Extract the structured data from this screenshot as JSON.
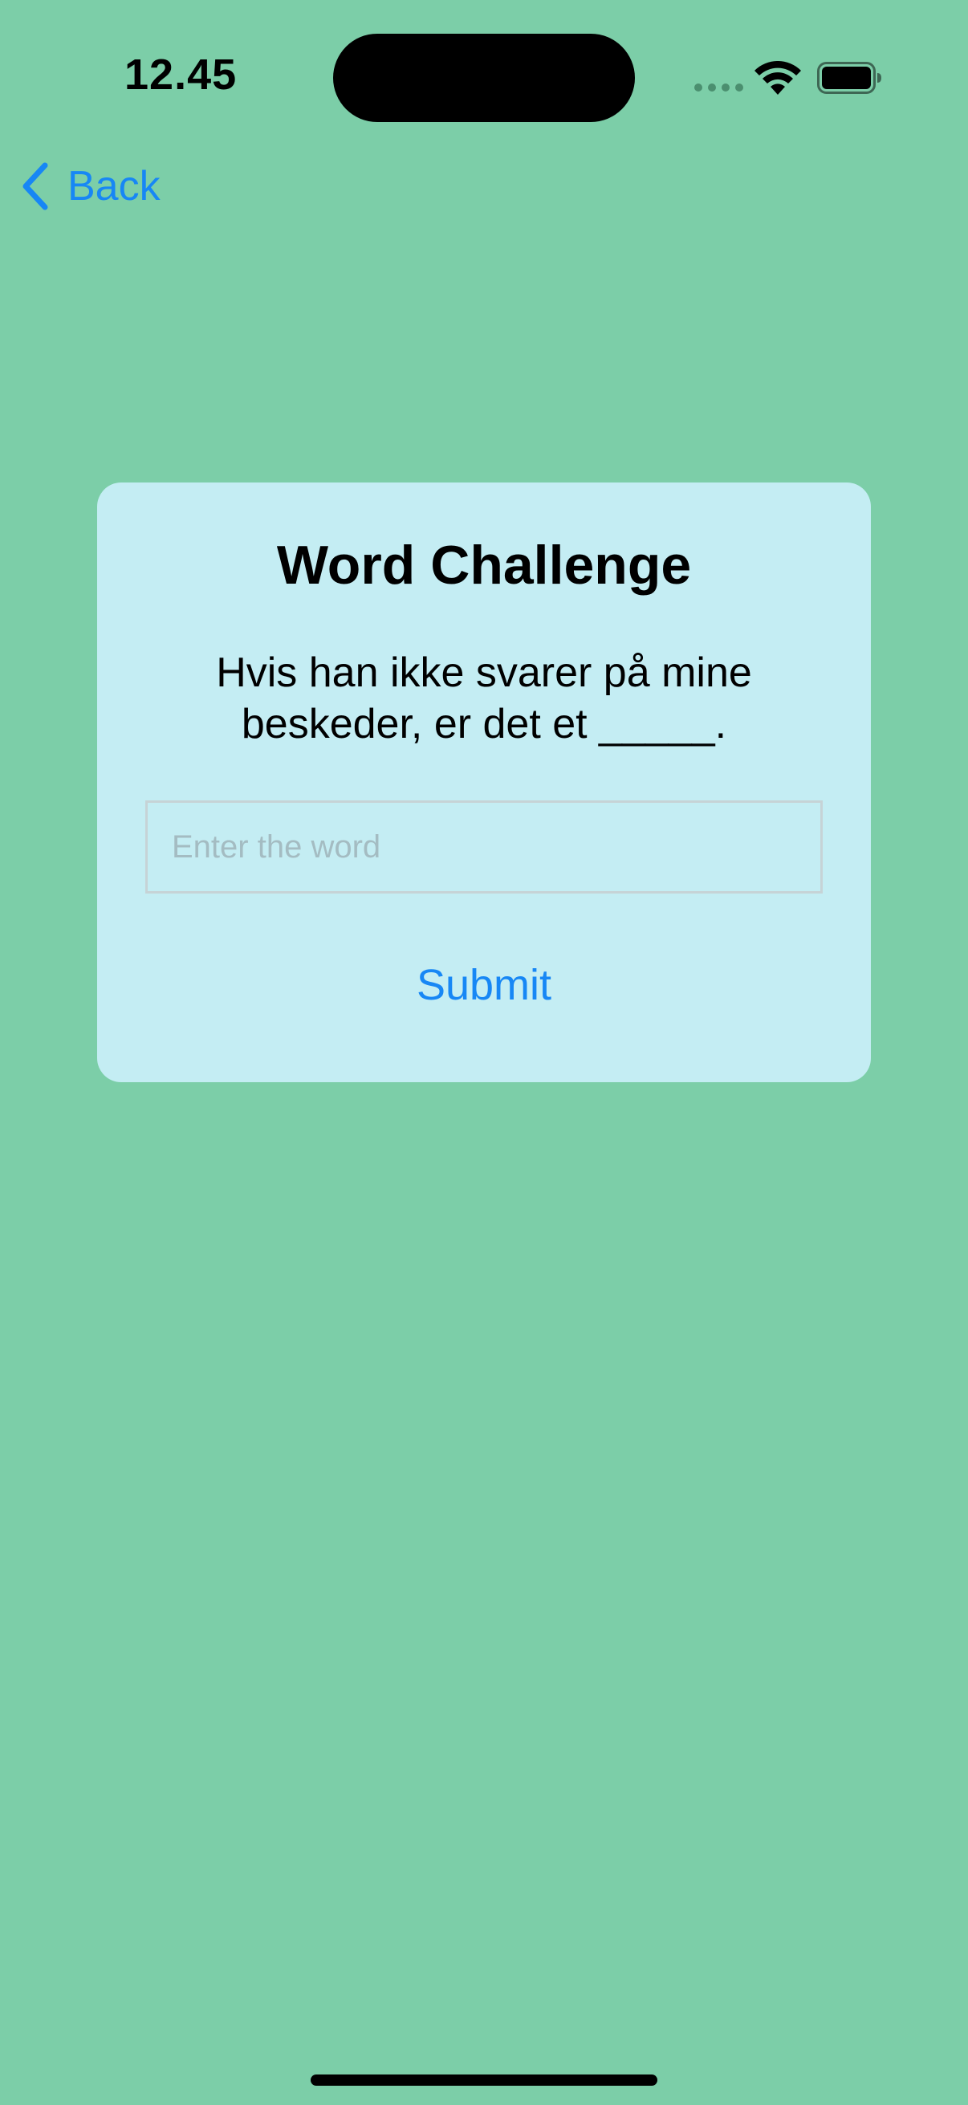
{
  "status_bar": {
    "time": "12.45",
    "icons": [
      "signal-icon",
      "wifi-icon",
      "battery-icon"
    ]
  },
  "nav": {
    "back_label": "Back",
    "back_icon": "chevron-left-icon"
  },
  "challenge": {
    "title": "Word Challenge",
    "question": "Hvis han ikke svarer på mine beskeder, er det et _____.",
    "input_value": "",
    "input_placeholder": "Enter the word",
    "submit_label": "Submit"
  },
  "colors": {
    "background": "#7CCEA8",
    "card": "#C4EDF3",
    "accent": "#1787F5"
  }
}
